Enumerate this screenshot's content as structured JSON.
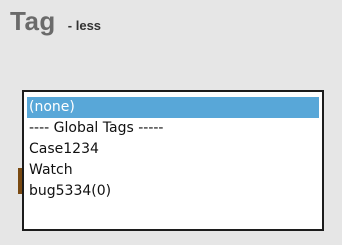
{
  "header": {
    "title": "Tag",
    "toggle_label": "- less"
  },
  "tag_list": {
    "selected_index": 0,
    "options": [
      {
        "label": "(none)",
        "selected": true
      },
      {
        "label": "---- Global Tags -----",
        "selected": false
      },
      {
        "label": "Case1234",
        "selected": false
      },
      {
        "label": "Watch",
        "selected": false
      },
      {
        "label": "bug5334(0)",
        "selected": false
      }
    ]
  },
  "colors": {
    "panel_background": "#e6e6e6",
    "title_text": "#6a6a6a",
    "selection_highlight": "#58a7d8",
    "listbox_border": "#1c1c1c"
  }
}
